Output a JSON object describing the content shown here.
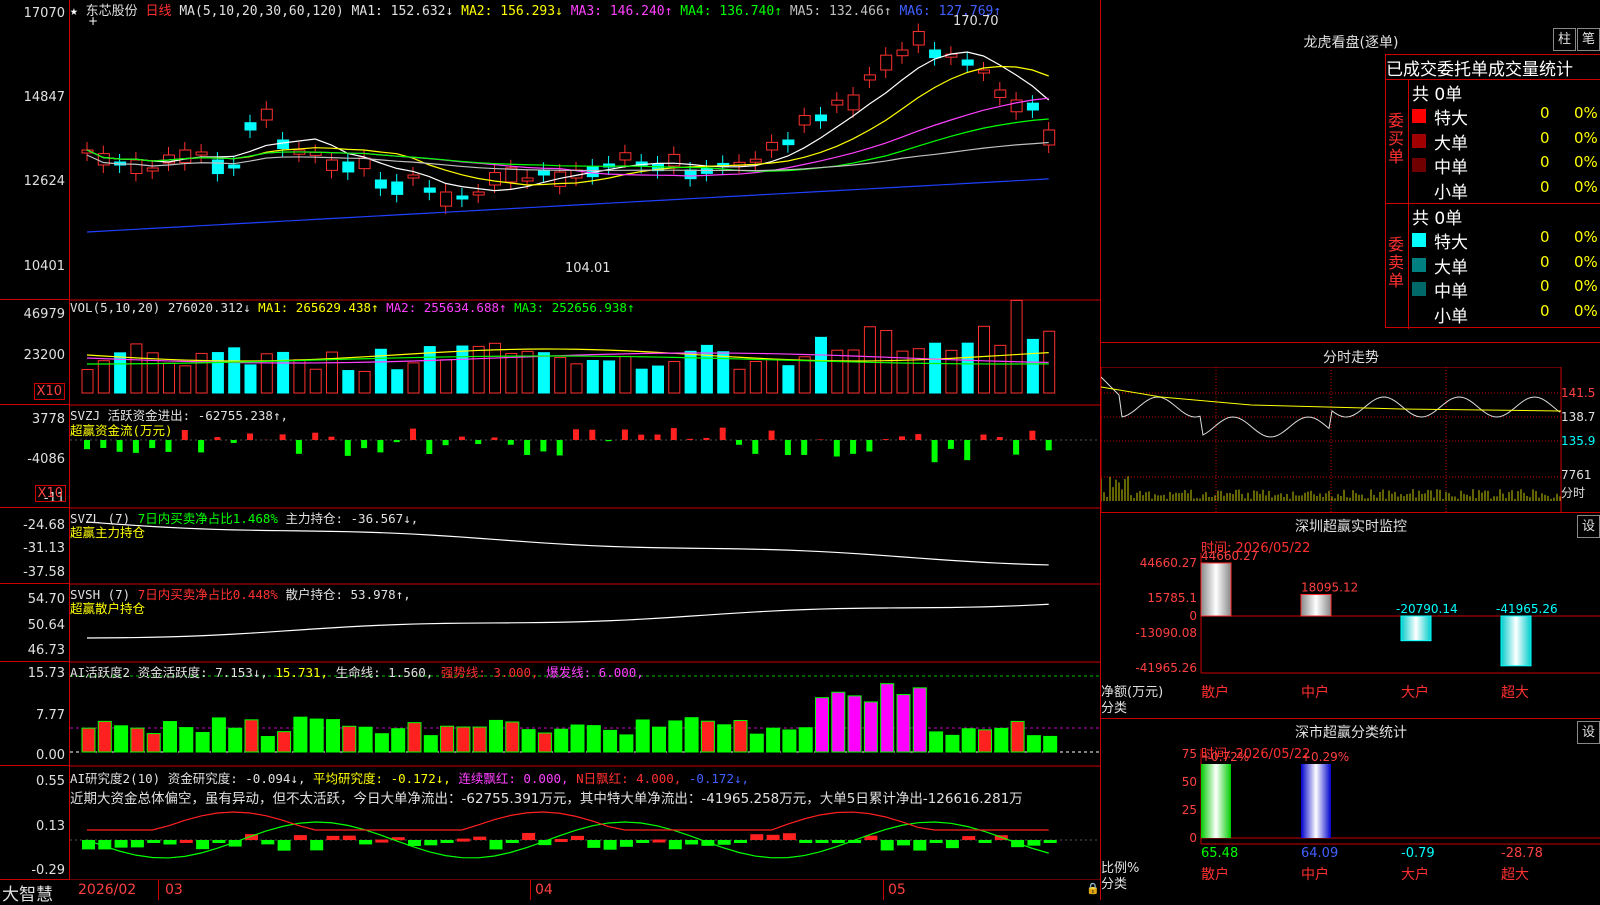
{
  "stock": {
    "name": "东芯股份",
    "period": "日线",
    "star": "★",
    "cursor": "+"
  },
  "ma": {
    "label": "MA(5,10,20,30,60,120)",
    "ma1": "MA1: 152.632↓",
    "ma2": "MA2: 156.293↓",
    "ma3": "MA3: 146.240↑",
    "ma4": "MA4: 136.740↑",
    "ma5": "MA5: 132.466↑",
    "ma6": "MA6: 127.769↑",
    "high": "170.70",
    "low": "104.01"
  },
  "price_axis": [
    "17070",
    "14847",
    "12624",
    "10401"
  ],
  "vol": {
    "label": "VOL(5,10,20)",
    "value": "276020.312↓",
    "ma1": "MA1: 265629.438↑",
    "ma2": "MA2: 255634.688↑",
    "ma3": "MA3: 252656.938↑",
    "axis": [
      "46979",
      "23200"
    ],
    "unit": "X10"
  },
  "svzj": {
    "label": "SVZJ",
    "desc": "活跃资金进出: -62755.238↑,",
    "sub": "超赢资金流(万元)",
    "axis": [
      "3778",
      "-4086",
      "-11"
    ],
    "unit": "X10"
  },
  "svzl": {
    "label": "SVZL (7)",
    "desc": "7日内买卖净占比1.468%",
    "desc2": "主力持仓: -36.567↓,",
    "sub": "超赢主力持仓",
    "axis": [
      "-24.68",
      "-31.13",
      "-37.58"
    ]
  },
  "svsh": {
    "label": "SVSH (7)",
    "desc": "7日内买卖净占比0.448%",
    "desc2": "散户持仓: 53.978↑,",
    "sub": "超赢散户持仓",
    "axis": [
      "54.70",
      "50.64",
      "46.73"
    ]
  },
  "ai2": {
    "label": "AI活跃度2",
    "a": "资金活跃度: 7.153↓,",
    "b": "15.731,",
    "c": "生命线: 1.560,",
    "d": "强势线: 3.000,",
    "e": "爆发线: 6.000,",
    "axis": [
      "15.73",
      "7.77",
      "0.00"
    ]
  },
  "ai_r": {
    "label": "AI研究度2(10)",
    "a": "资金研究度: -0.094↓,",
    "b": "平均研究度: -0.172↓,",
    "c": "连续飘红: 0.000,",
    "d": "N日飘红: 4.000,",
    "e": "-0.172↓,",
    "note": "近期大资金总体偏空，虽有异动，但不太活跃，今日大单净流出：-62755.391万元，其中特大单净流出：-41965.258万元，大单5日累计净出-126616.281万",
    "axis": [
      "0.55",
      "0.13",
      "-0.29"
    ]
  },
  "dates": {
    "brand": "大智慧",
    "d1": "2026/02",
    "d2": "03",
    "d3": "04",
    "d4": "05"
  },
  "longhu": {
    "title": "龙虎看盘(逐单)",
    "btn1": "柱",
    "btn2": "笔",
    "header": "已成交委托单成交量统计",
    "buy_side": "委买单",
    "sell_side": "委卖单",
    "buy_total": "共 0单",
    "sell_total": "共 0单",
    "buy_rows": [
      {
        "name": "特大",
        "val": "0",
        "pct": "0%",
        "color": "#ff0000"
      },
      {
        "name": "大单",
        "val": "0",
        "pct": "0%",
        "color": "#a00000"
      },
      {
        "name": "中单",
        "val": "0",
        "pct": "0%",
        "color": "#700000"
      },
      {
        "name": "小单",
        "val": "0",
        "pct": "0%",
        "color": "#000000"
      }
    ],
    "sell_rows": [
      {
        "name": "特大",
        "val": "0",
        "pct": "0%",
        "color": "#00ffff"
      },
      {
        "name": "大单",
        "val": "0",
        "pct": "0%",
        "color": "#008080"
      },
      {
        "name": "中单",
        "val": "0",
        "pct": "0%",
        "color": "#006868"
      },
      {
        "name": "小单",
        "val": "0",
        "pct": "0%",
        "color": "#000000"
      }
    ]
  },
  "fenshi": {
    "title": "分时走势",
    "p1": "141.5",
    "p2": "138.7",
    "p3": "135.9",
    "vol": "7761",
    "unit": "分时"
  },
  "sz_monitor": {
    "title": "深圳超赢实时监控",
    "btn": "设",
    "time": "时间: 2026/05/22",
    "axis": [
      "44660.27",
      "15785.1",
      "0",
      "-13090.08",
      "-41965.26"
    ],
    "ylabel": "净额(万元)",
    "xlabel": "分类",
    "bars": [
      {
        "cat": "散户",
        "val": 44660.27,
        "label": "44660.27"
      },
      {
        "cat": "中户",
        "val": 18095.12,
        "label": "18095.12"
      },
      {
        "cat": "大户",
        "val": -20790.14,
        "label": "-20790.14"
      },
      {
        "cat": "超大",
        "val": -41965.26,
        "label": "-41965.26"
      }
    ]
  },
  "sz_class": {
    "title": "深市超赢分类统计",
    "btn": "设",
    "time": "时间: 2026/05/22",
    "axis": [
      "75",
      "50",
      "25",
      "0"
    ],
    "ylabel": "比例%",
    "xlabel": "分类",
    "top1": "+0.72%",
    "top2": "+0.29%",
    "vals": [
      "65.48",
      "64.09",
      "-0.79",
      "-28.78"
    ],
    "cats": [
      "散户",
      "中户",
      "大户",
      "超大"
    ]
  }
}
